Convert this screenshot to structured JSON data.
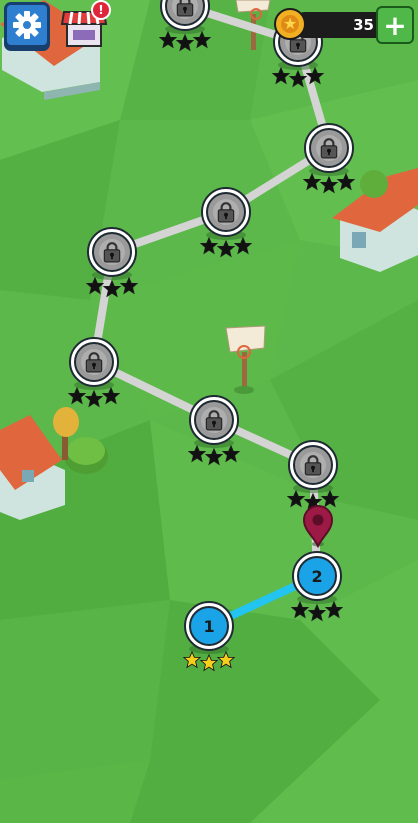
{
  "hud": {
    "coins": "35",
    "settings_icon": "gear-icon",
    "shop_icon": "shop-stall-icon",
    "shop_badge": "!",
    "add_coins_label": "+"
  },
  "levels": [
    {
      "label": "1",
      "state": "completed",
      "stars": 3
    },
    {
      "label": "2",
      "state": "current",
      "stars": 0
    },
    {
      "label": "",
      "state": "locked",
      "stars": 0
    },
    {
      "label": "",
      "state": "locked",
      "stars": 0
    },
    {
      "label": "",
      "state": "locked",
      "stars": 0
    },
    {
      "label": "",
      "state": "locked",
      "stars": 0
    },
    {
      "label": "",
      "state": "locked",
      "stars": 0
    },
    {
      "label": "",
      "state": "locked",
      "stars": 0
    },
    {
      "label": "",
      "state": "locked",
      "stars": 0
    },
    {
      "label": "",
      "state": "locked",
      "stars": 0
    }
  ],
  "colors": {
    "grass": "#5cb84a",
    "unlocked": "#1aa3e6",
    "locked": "#9a9a9a",
    "path_locked": "#d4d4d4",
    "path_unlocked": "#23c4f0",
    "star_earned": "#f6cf1a",
    "star_empty": "#111111",
    "marker": "#9c1a45",
    "roof": "#e0663e"
  }
}
